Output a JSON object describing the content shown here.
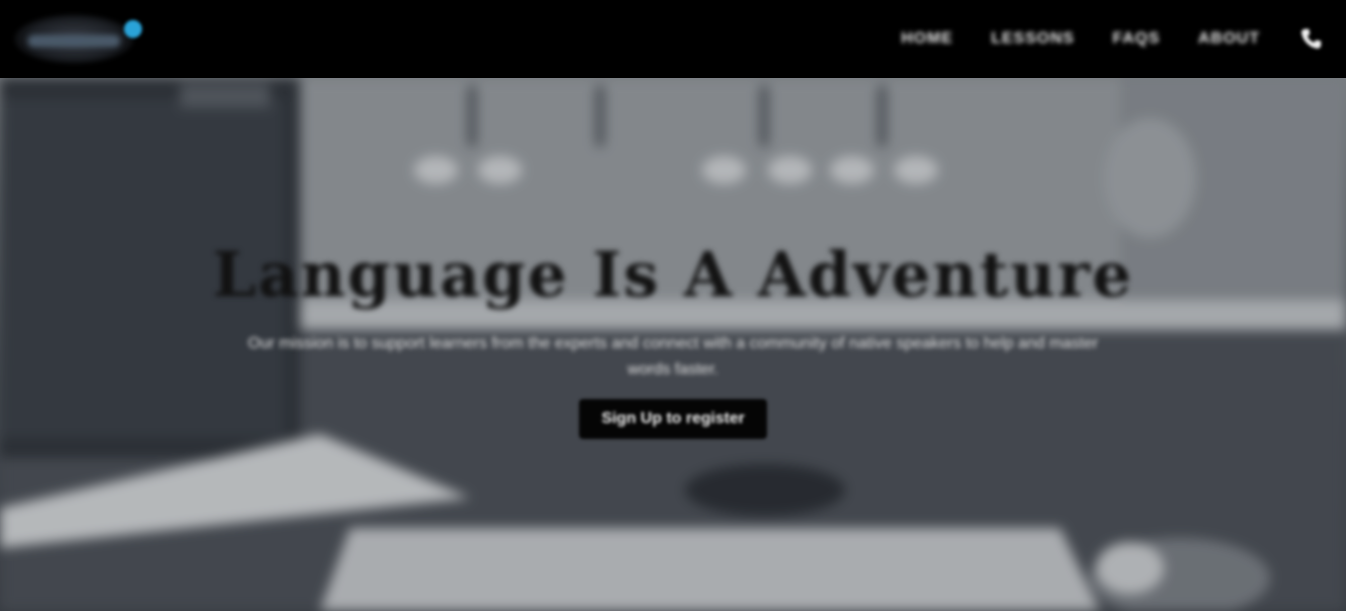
{
  "nav": {
    "items": [
      {
        "label": "HOME"
      },
      {
        "label": "LESSONS"
      },
      {
        "label": "FAQS"
      },
      {
        "label": "ABOUT"
      }
    ],
    "phone_icon": "phone-icon"
  },
  "hero": {
    "title": "Language Is A Adventure",
    "subtitle": "Our mission is to support learners from the experts and connect with a community of native speakers to help and master words faster.",
    "cta_label": "Sign Up to register"
  },
  "colors": {
    "navbar_bg": "#000000",
    "accent": "#2aa3d8",
    "title": "#121212",
    "cta_bg": "#050505"
  }
}
